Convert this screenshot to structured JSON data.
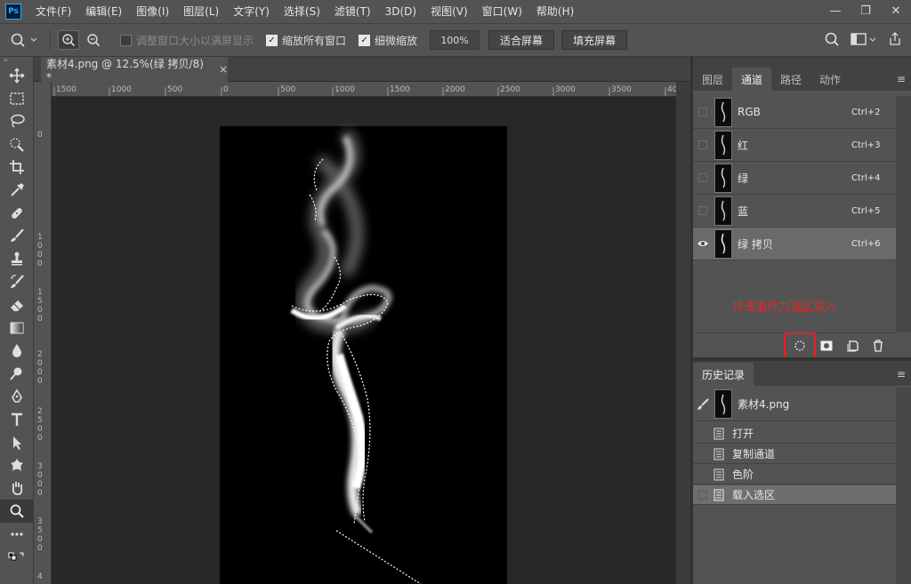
{
  "app": {
    "logo": "Ps"
  },
  "menu": [
    "文件(F)",
    "编辑(E)",
    "图像(I)",
    "图层(L)",
    "文字(Y)",
    "选择(S)",
    "滤镜(T)",
    "3D(D)",
    "视图(V)",
    "窗口(W)",
    "帮助(H)"
  ],
  "window_controls": {
    "minimize": "—",
    "restore": "❐",
    "close": "✕"
  },
  "options": {
    "resize_windows_label": "调整窗口大小以满屏显示",
    "zoom_all_label": "缩放所有窗口",
    "scrubby_zoom_label": "细微缩放",
    "zoom_value": "100%",
    "fit_screen": "适合屏幕",
    "fill_screen": "填充屏幕"
  },
  "document": {
    "tab_title": "素材4.png @ 12.5%(绿 拷贝/8) *",
    "close": "×"
  },
  "ruler_h": [
    "1500",
    "1000",
    "500",
    "0",
    "500",
    "1000",
    "1500",
    "2000",
    "2500",
    "3000",
    "3500",
    "40"
  ],
  "ruler_v": [
    "0",
    "1\n0\n0\n0",
    "1\n5\n0\n0",
    "2\n0\n0\n0",
    "2\n5\n0\n0",
    "3\n0\n0\n0",
    "3\n5\n0\n0",
    "4"
  ],
  "panel_tabs": [
    "图层",
    "通道",
    "路径",
    "动作"
  ],
  "channels": [
    {
      "name": "RGB",
      "shortcut": "Ctrl+2",
      "visible": false
    },
    {
      "name": "红",
      "shortcut": "Ctrl+3",
      "visible": false
    },
    {
      "name": "绿",
      "shortcut": "Ctrl+4",
      "visible": false
    },
    {
      "name": "蓝",
      "shortcut": "Ctrl+5",
      "visible": false
    },
    {
      "name": "绿 拷贝",
      "shortcut": "Ctrl+6",
      "visible": true
    }
  ],
  "annotation": "将通道作为选区载入",
  "colors": {
    "annotation": "#e02a2a",
    "highlight_box": "#e0232a"
  },
  "history": {
    "tab": "历史记录",
    "snapshot": "素材4.png",
    "items": [
      "打开",
      "复制通道",
      "色阶",
      "载入选区"
    ]
  }
}
